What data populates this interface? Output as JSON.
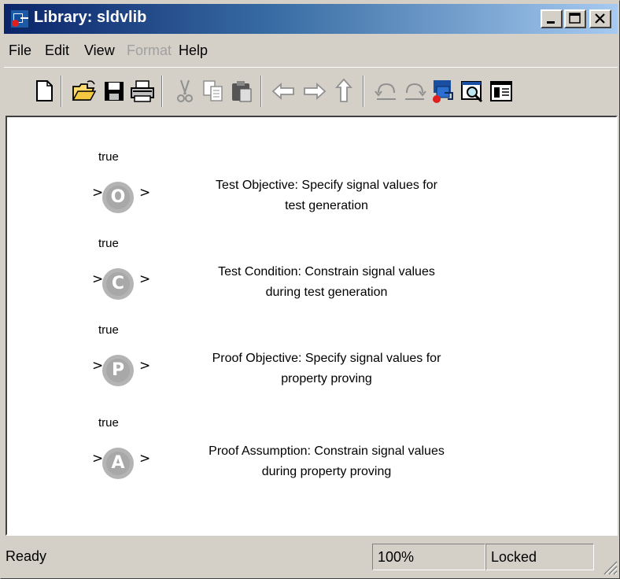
{
  "window": {
    "title": "Library: sldvlib"
  },
  "title_buttons": [
    "minimize",
    "maximize",
    "close"
  ],
  "menu": [
    {
      "label": "File",
      "enabled": true
    },
    {
      "label": "Edit",
      "enabled": true
    },
    {
      "label": "View",
      "enabled": true
    },
    {
      "label": "Format",
      "enabled": false
    },
    {
      "label": "Help",
      "enabled": true
    }
  ],
  "toolbar": {
    "items": [
      {
        "icon": "new-icon"
      },
      {
        "icon": "open-icon"
      },
      {
        "icon": "save-icon"
      },
      {
        "icon": "print-icon"
      },
      {
        "icon": "cut-icon",
        "enabled": false
      },
      {
        "icon": "copy-icon",
        "enabled": false
      },
      {
        "icon": "paste-icon"
      },
      {
        "icon": "back-icon",
        "enabled": false
      },
      {
        "icon": "forward-icon",
        "enabled": false
      },
      {
        "icon": "up-icon",
        "enabled": false
      },
      {
        "icon": "undo-icon",
        "enabled": false
      },
      {
        "icon": "redo-icon",
        "enabled": false
      },
      {
        "icon": "library-browser-icon"
      },
      {
        "icon": "model-explorer-icon"
      },
      {
        "icon": "block-properties-icon"
      }
    ]
  },
  "blocks": [
    {
      "letter": "O",
      "port_label": "true",
      "in": ">",
      "out": ">",
      "line1": "Test Objective: Specify signal values for",
      "line2": "test generation"
    },
    {
      "letter": "C",
      "port_label": "true",
      "in": ">",
      "out": ">",
      "line1": "Test Condition: Constrain signal values",
      "line2": "during test generation"
    },
    {
      "letter": "P",
      "port_label": "true",
      "in": ">",
      "out": ">",
      "line1": "Proof Objective: Specify signal values for",
      "line2": "property proving"
    },
    {
      "letter": "A",
      "port_label": "true",
      "in": ">",
      "out": ">",
      "line1": "Proof Assumption: Constrain signal values",
      "line2": "during property proving"
    }
  ],
  "status": {
    "ready": "Ready",
    "zoom": "100%",
    "lock": "Locked"
  },
  "colors": {
    "title_bar_start": "#0a246a",
    "title_bar_end": "#a6caf0",
    "chrome": "#d4d0c8",
    "badge": "#a8a8a8"
  }
}
